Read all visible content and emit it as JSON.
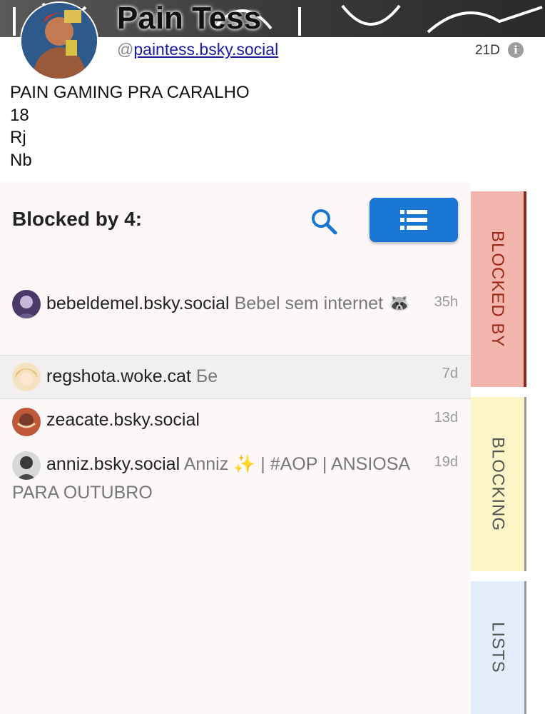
{
  "profile": {
    "display_name": "Pain Tess",
    "handle_prefix": "@",
    "handle": "paintess.bsky.social",
    "age": "21D",
    "bio_lines": [
      "PAIN GAMING PRA CARALHO",
      "18",
      "Rj",
      "Nb"
    ]
  },
  "panel": {
    "title": "Blocked by 4:"
  },
  "rows": [
    {
      "handle": "bebeldemel.bsky.social",
      "desc": "Bebel sem internet 🦝",
      "time": "35h",
      "avatar_color": "#4a3a6a"
    },
    {
      "handle": "regshota.woke.cat",
      "desc": "Бе",
      "time": "7d",
      "avatar_color": "#e8c27a"
    },
    {
      "handle": "zeacate.bsky.social",
      "desc": "",
      "time": "13d",
      "avatar_color": "#7a3a2a"
    },
    {
      "handle": "anniz.bsky.social",
      "desc": "Anniz ✨ | #AOP | ANSIOSA PARA OUTUBRO",
      "time": "19d",
      "avatar_color": "#4a4a4a"
    }
  ],
  "tabs": {
    "blocked_by": "BLOCKED BY",
    "blocking": "BLOCKING",
    "lists": "LISTS"
  },
  "colors": {
    "accent": "#1976d2",
    "blocked_by_bg": "#f3b6ae",
    "blocking_bg": "#fdf5c8",
    "lists_bg": "#e3ecfb"
  }
}
